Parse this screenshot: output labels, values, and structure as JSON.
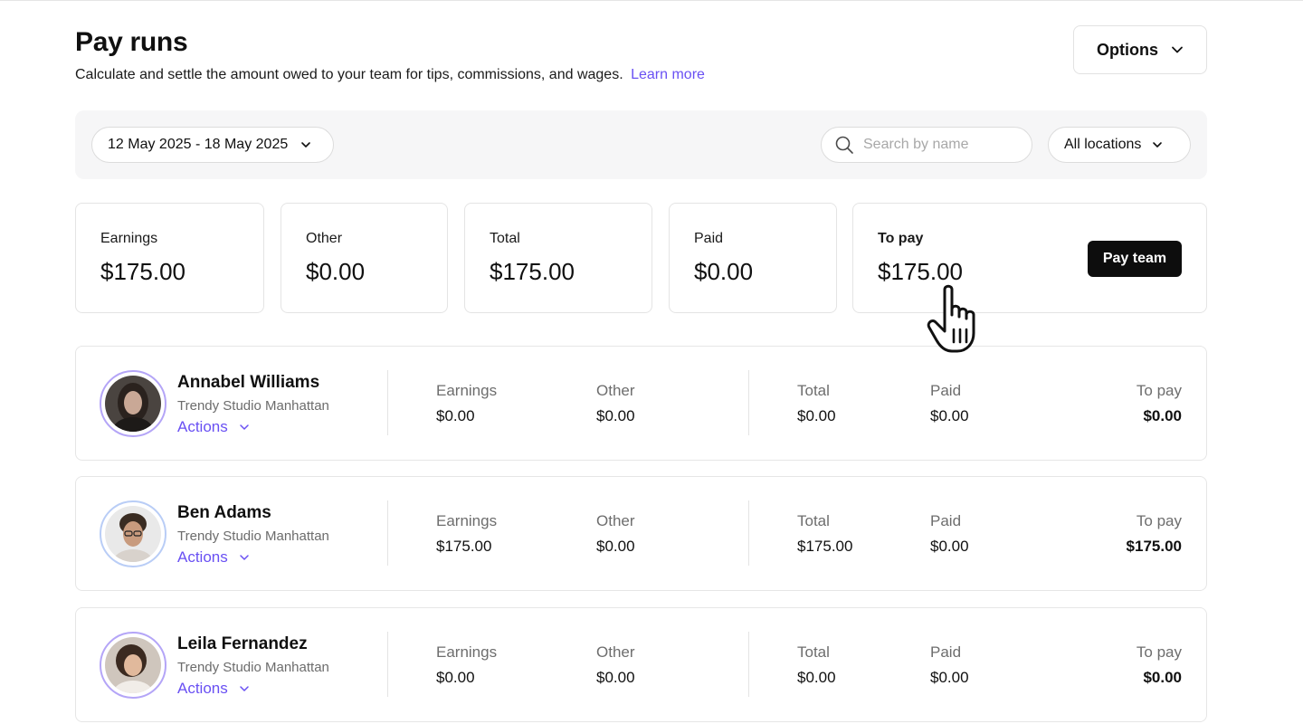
{
  "header": {
    "title": "Pay runs",
    "subtitle": "Calculate and settle the amount owed to your team for tips, commissions, and wages.",
    "learn_more": "Learn more",
    "options_label": "Options"
  },
  "filters": {
    "date_range": "12 May 2025 - 18 May 2025",
    "search_placeholder": "Search by name",
    "location": "All locations"
  },
  "summary": {
    "earnings": {
      "label": "Earnings",
      "value": "$175.00"
    },
    "other": {
      "label": "Other",
      "value": "$0.00"
    },
    "total": {
      "label": "Total",
      "value": "$175.00"
    },
    "paid": {
      "label": "Paid",
      "value": "$0.00"
    },
    "to_pay": {
      "label": "To pay",
      "value": "$175.00"
    },
    "pay_team_label": "Pay team"
  },
  "members": [
    {
      "name": "Annabel Williams",
      "location": "Trendy Studio Manhattan",
      "actions": "Actions",
      "labels": {
        "earnings": "Earnings",
        "other": "Other",
        "total": "Total",
        "paid": "Paid",
        "to_pay": "To pay"
      },
      "earnings": "$0.00",
      "other": "$0.00",
      "total": "$0.00",
      "paid": "$0.00",
      "to_pay": "$0.00"
    },
    {
      "name": "Ben Adams",
      "location": "Trendy Studio Manhattan",
      "actions": "Actions",
      "labels": {
        "earnings": "Earnings",
        "other": "Other",
        "total": "Total",
        "paid": "Paid",
        "to_pay": "To pay"
      },
      "earnings": "$175.00",
      "other": "$0.00",
      "total": "$175.00",
      "paid": "$0.00",
      "to_pay": "$175.00"
    },
    {
      "name": "Leila Fernandez",
      "location": "Trendy Studio Manhattan",
      "actions": "Actions",
      "labels": {
        "earnings": "Earnings",
        "other": "Other",
        "total": "Total",
        "paid": "Paid",
        "to_pay": "To pay"
      },
      "earnings": "$0.00",
      "other": "$0.00",
      "total": "$0.00",
      "paid": "$0.00",
      "to_pay": "$0.00"
    }
  ],
  "colors": {
    "accent": "#6950f3",
    "primary_button": "#0d0d0d",
    "filter_bar_bg": "#f6f6f7"
  },
  "icons": {
    "options": "chevron-down-icon",
    "date": "chevron-down-icon",
    "search": "search-icon",
    "location": "chevron-down-icon",
    "actions": "chevron-down-icon",
    "cursor": "hand-pointer-cursor"
  }
}
